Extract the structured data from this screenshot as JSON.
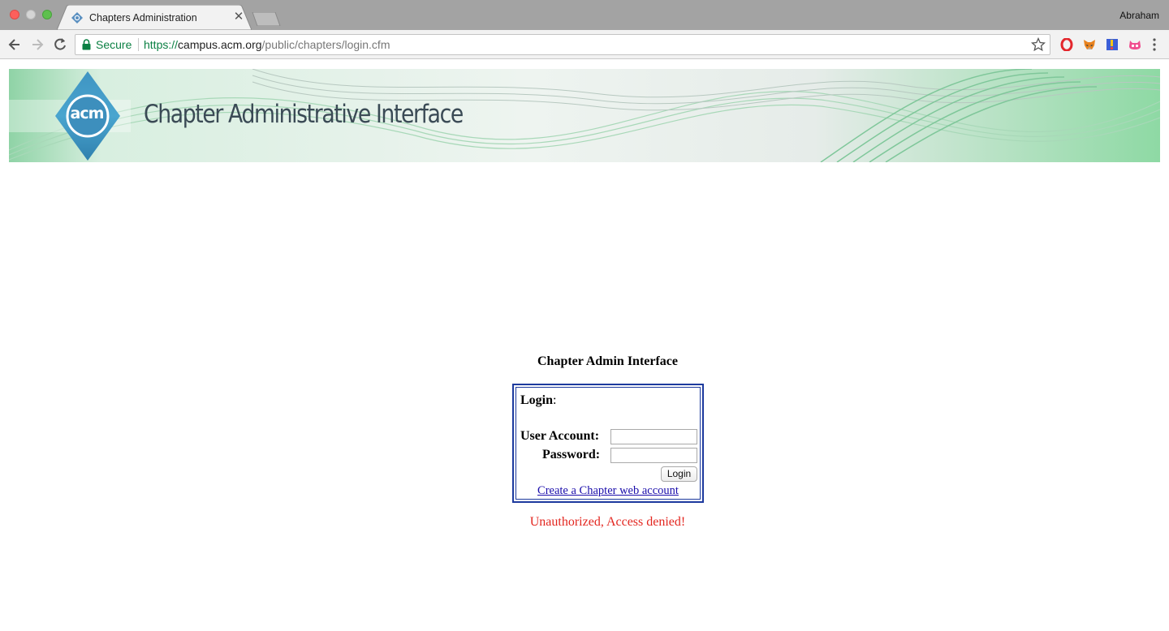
{
  "browser": {
    "tab_title": "Chapters Administration",
    "profile_name": "Abraham",
    "secure_label": "Secure",
    "url_scheme": "https://",
    "url_host": "campus.acm.org",
    "url_path": "/public/chapters/login.cfm",
    "extensions": [
      "opera-icon",
      "metamask-fox-icon",
      "bookmark-flag-icon",
      "cat-face-icon"
    ]
  },
  "banner": {
    "logo_text": "acm",
    "title": "Chapter Administrative Interface"
  },
  "page": {
    "title": "Chapter Admin Interface",
    "login_heading": "Login",
    "login_colon": ":",
    "user_label": "User Account:",
    "password_label": "Password:",
    "user_value": "",
    "password_value": "",
    "login_button": "Login",
    "create_link": "Create a Chapter web account",
    "error_message": "Unauthorized, Access denied!"
  },
  "colors": {
    "box_border": "#1d3a9e",
    "link": "#1a0dab",
    "error": "#e3261f",
    "secure_green": "#0b8043"
  }
}
